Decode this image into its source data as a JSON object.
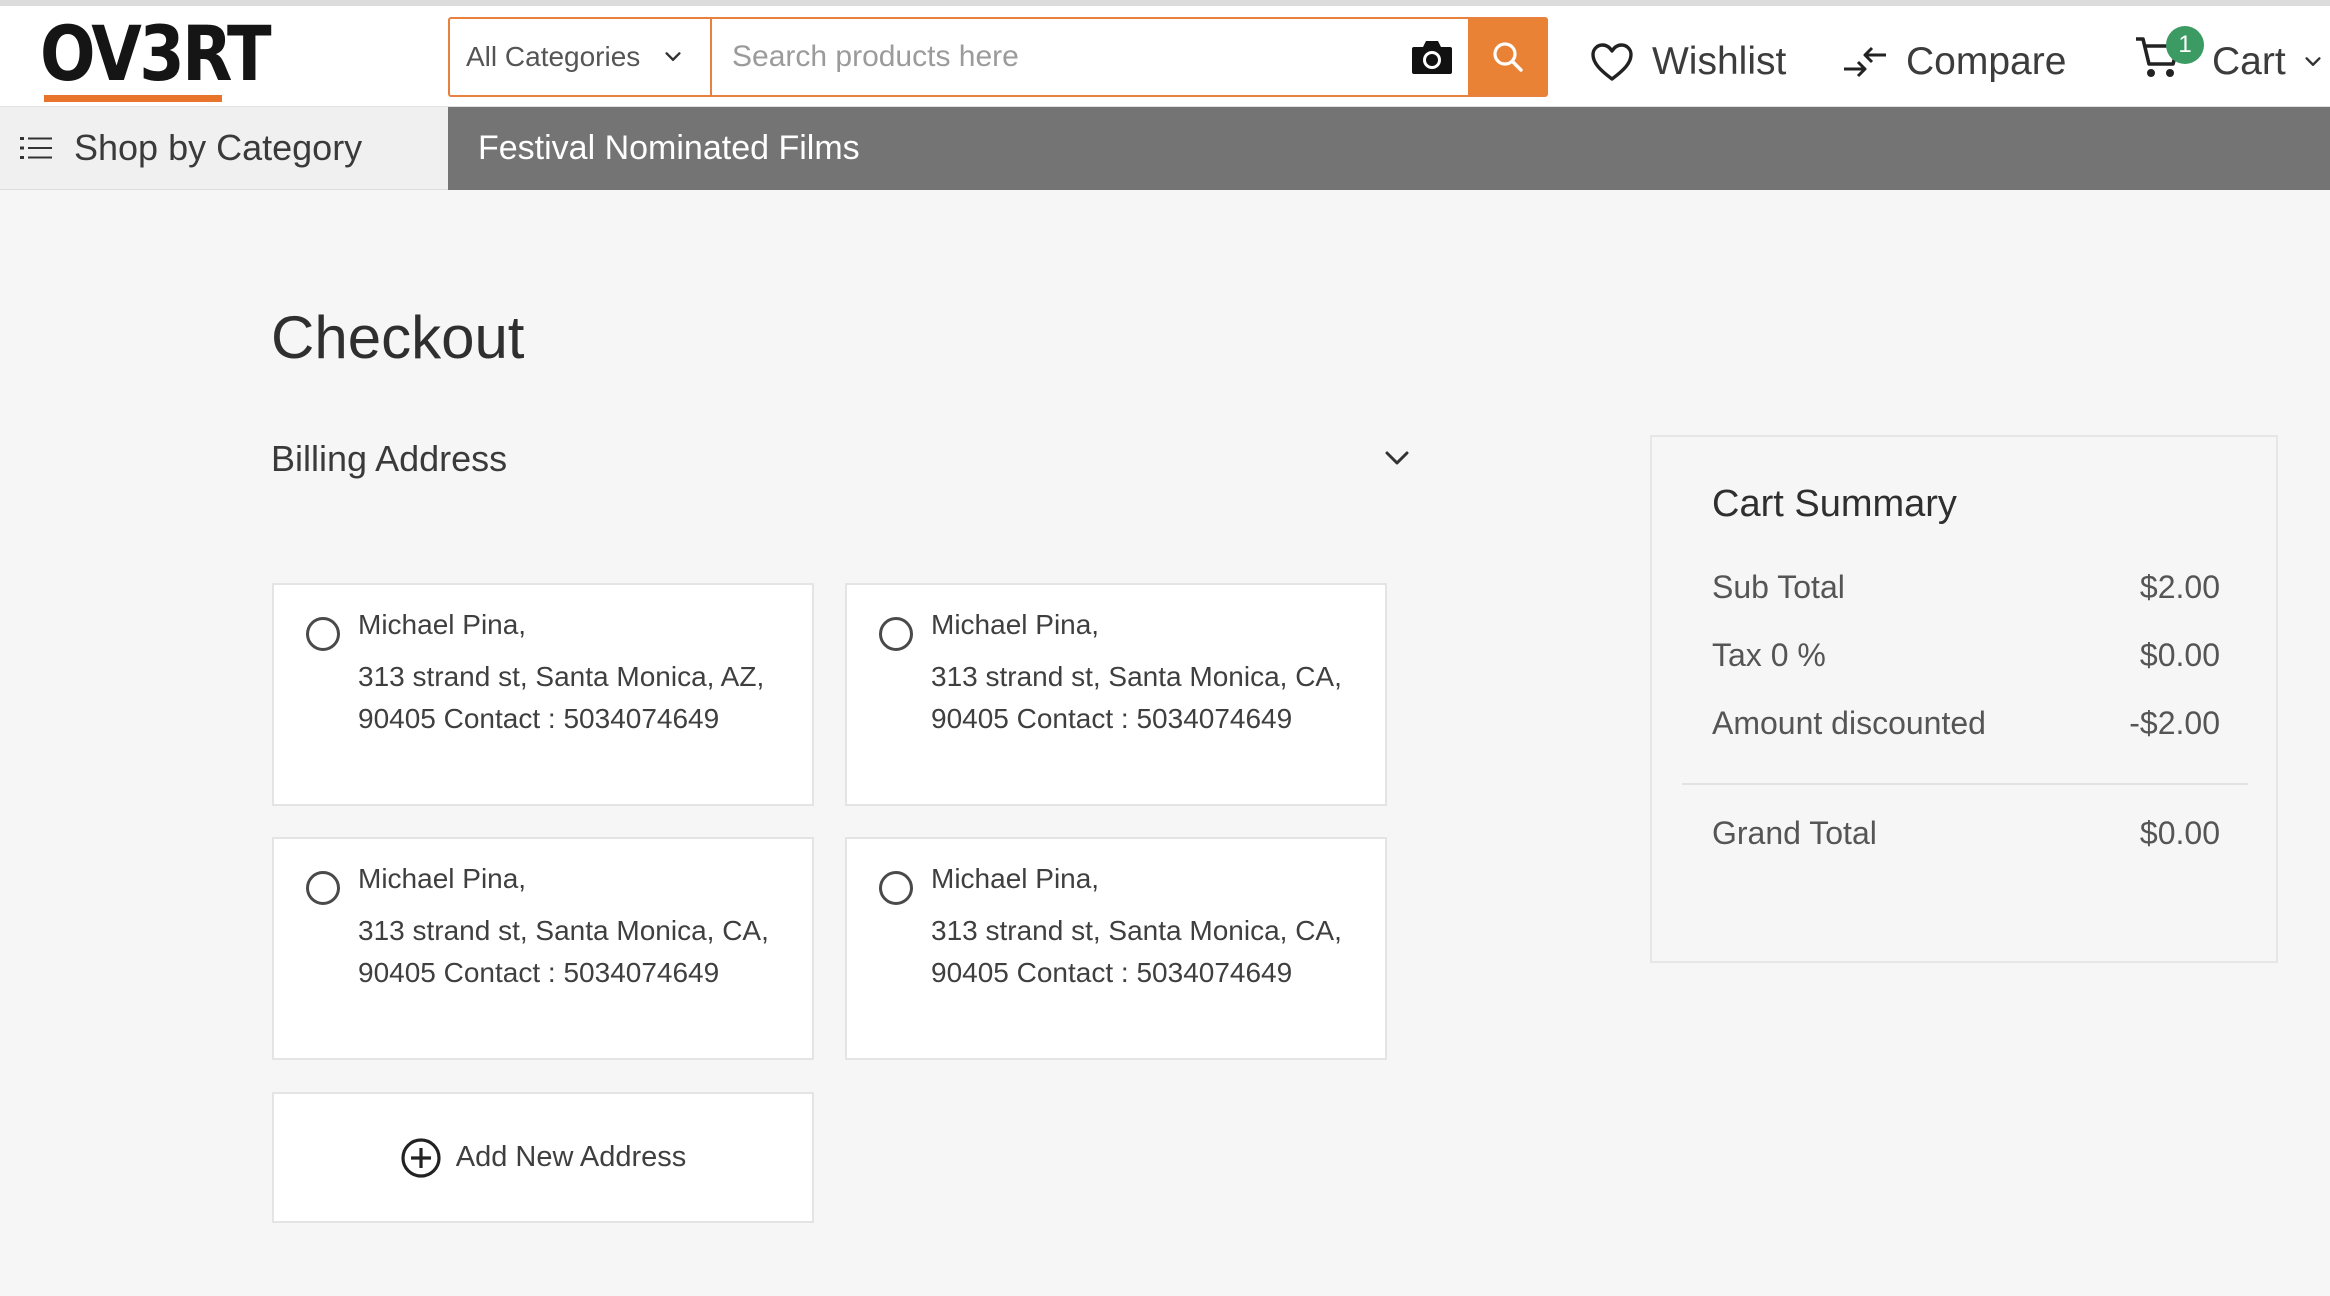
{
  "header": {
    "logo_text": "OV3RT",
    "category_select": "All Categories",
    "search_placeholder": "Search products here",
    "wishlist_label": "Wishlist",
    "compare_label": "Compare",
    "cart_label": "Cart",
    "cart_count": "1"
  },
  "nav": {
    "shop_by_category": "Shop by Category",
    "links": [
      "Festival Nominated Films"
    ]
  },
  "main": {
    "title": "Checkout",
    "billing_title": "Billing Address",
    "addresses": [
      {
        "name": "Michael Pina,",
        "line1": "313 strand st, Santa Monica, AZ,",
        "line2": "90405 Contact : 5034074649"
      },
      {
        "name": "Michael Pina,",
        "line1": "313 strand st, Santa Monica, CA,",
        "line2": "90405 Contact : 5034074649"
      },
      {
        "name": "Michael Pina,",
        "line1": "313 strand st, Santa Monica, CA,",
        "line2": "90405 Contact : 5034074649"
      },
      {
        "name": "Michael Pina,",
        "line1": "313 strand st, Santa Monica, CA,",
        "line2": "90405 Contact : 5034074649"
      }
    ],
    "add_address_label": "Add New Address"
  },
  "summary": {
    "title": "Cart Summary",
    "rows": [
      {
        "label": "Sub Total",
        "value": "$2.00"
      },
      {
        "label": "Tax 0 %",
        "value": "$0.00"
      },
      {
        "label": "Amount discounted",
        "value": "-$2.00"
      }
    ],
    "grand_total_label": "Grand Total",
    "grand_total_value": "$0.00"
  },
  "colors": {
    "accent": "#ea8236",
    "nav_bar": "#747474",
    "badge": "#3c9a63"
  }
}
